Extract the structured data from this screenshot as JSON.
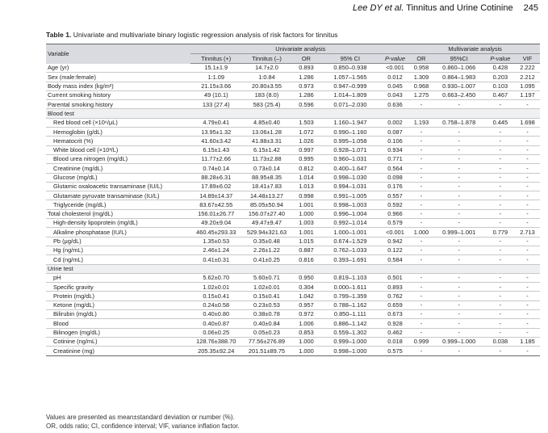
{
  "running_head": {
    "authors": "Lee DY et al.",
    "title": "Tinnitus and Urine Cotinine",
    "page": "245"
  },
  "caption": {
    "label": "Table 1.",
    "text": "Univariate and multivariate binary logistic regression analysis of risk factors for tinnitus"
  },
  "header": {
    "variable": "Variable",
    "univariate": "Univariate analysis",
    "multivariate": "Multivariate analysis",
    "uni_cols": [
      "Tinnitus (+)",
      "Tinnitus (–)",
      "OR",
      "95% CI",
      "P-value"
    ],
    "multi_cols": [
      "OR",
      "95%CI",
      "P-value",
      "VIF"
    ]
  },
  "rows": [
    {
      "label": "Age (yr)",
      "indent": false,
      "section": false,
      "cells": [
        "15.1±1.9",
        "14.7±2.0",
        "0.893",
        "0.850–0.938",
        "<0.001",
        "0.958",
        "0.860–1.066",
        "0.428",
        "2.222"
      ]
    },
    {
      "label": "Sex (male:female)",
      "indent": false,
      "section": false,
      "cells": [
        "1:1.09",
        "1:0.84",
        "1.286",
        "1.057–1.565",
        "0.012",
        "1.309",
        "0.864–1.983",
        "0.203",
        "2.212"
      ]
    },
    {
      "label": "Body mass index (kg/m²)",
      "indent": false,
      "section": false,
      "cells": [
        "21.15±3.66",
        "20.80±3.55",
        "0.973",
        "0.947–0.999",
        "0.045",
        "0.968",
        "0.930–1.007",
        "0.103",
        "1.095"
      ]
    },
    {
      "label": "Current smoking history",
      "indent": false,
      "section": false,
      "cells": [
        "49 (10.1)",
        "183 (8.0)",
        "1.286",
        "1.014–1.809",
        "0.043",
        "1.275",
        "0.663–2.450",
        "0.467",
        "1.197"
      ]
    },
    {
      "label": "Parental smoking history",
      "indent": false,
      "section": false,
      "cells": [
        "133 (27.4)",
        "583 (25.4)",
        "0.596",
        "0.071–2.030",
        "0.636",
        "-",
        "-",
        "-",
        "-"
      ]
    },
    {
      "label": "Blood test",
      "indent": false,
      "section": true,
      "cells": [
        "",
        "",
        "",
        "",
        "",
        "",
        "",
        "",
        ""
      ]
    },
    {
      "label": "Red blood cell (×10⁶/μL)",
      "indent": true,
      "section": false,
      "cells": [
        "4.79±0.41",
        "4.85±0.40",
        "1.503",
        "1.160–1.947",
        "0.002",
        "1.193",
        "0.758–1.878",
        "0.445",
        "1.698"
      ]
    },
    {
      "label": "Hemoglobin (g/dL)",
      "indent": true,
      "section": false,
      "cells": [
        "13.95±1.32",
        "13.06±1.28",
        "1.072",
        "0.990–1.160",
        "0.087",
        "-",
        "-",
        "-",
        "-"
      ]
    },
    {
      "label": "Hematocrit (%)",
      "indent": true,
      "section": false,
      "cells": [
        "41.60±3.42",
        "41.88±3.31",
        "1.026",
        "0.995–1.058",
        "0.106",
        "-",
        "-",
        "-",
        "-"
      ]
    },
    {
      "label": "White blood cell (×10³/L)",
      "indent": true,
      "section": false,
      "cells": [
        "6.15±1.43",
        "6.15±1.42",
        "0.997",
        "0.928–1.071",
        "0.934",
        "-",
        "-",
        "-",
        "-"
      ]
    },
    {
      "label": "Blood urea nitrogen (mg/dL)",
      "indent": true,
      "section": false,
      "cells": [
        "11.77±2.66",
        "11.73±2.88",
        "0.995",
        "0.960–1.031",
        "0.771",
        "-",
        "-",
        "-",
        "-"
      ]
    },
    {
      "label": "Creatinine (mg/dL)",
      "indent": true,
      "section": false,
      "cells": [
        "0.74±0.14",
        "0.73±0.14",
        "0.812",
        "0.400–1.647",
        "0.564",
        "-",
        "-",
        "-",
        "-"
      ]
    },
    {
      "label": "Glucose (mg/dL)",
      "indent": true,
      "section": false,
      "cells": [
        "88.28±6.31",
        "88.95±8.35",
        "1.014",
        "0.998–1.030",
        "0.098",
        "-",
        "-",
        "-",
        "-"
      ]
    },
    {
      "label": "Glutamic oxaloacetic transaminase (IU/L)",
      "indent": true,
      "section": false,
      "cells": [
        "17.89±6.02",
        "18.41±7.83",
        "1.013",
        "0.994–1.031",
        "0.176",
        "-",
        "-",
        "-",
        "-"
      ]
    },
    {
      "label": "Glutamate pyruvate transaminase (IU/L)",
      "indent": true,
      "section": false,
      "cells": [
        "14.89±14.37",
        "14.48±13.27",
        "0.998",
        "0.991–1.005",
        "0.557",
        "-",
        "-",
        "-",
        "-"
      ]
    },
    {
      "label": "Triglyceride (mg/dL)",
      "indent": true,
      "section": false,
      "cells": [
        "83.67±42.55",
        "85.05±50.94",
        "1.001",
        "0.998–1.003",
        "0.592",
        "-",
        "-",
        "-",
        "-"
      ]
    },
    {
      "label": "Total cholesterol (mg/dL)",
      "indent": false,
      "section": false,
      "cells": [
        "156.01±26.77",
        "156.07±27.40",
        "1.000",
        "0.996–1.004",
        "0.966",
        "-",
        "-",
        "-",
        "-"
      ]
    },
    {
      "label": "High-density lipoprotein (mg/dL)",
      "indent": true,
      "section": false,
      "cells": [
        "49.20±9.04",
        "49.47±9.47",
        "1.003",
        "0.992–1.014",
        "0.579",
        "-",
        "-",
        "-",
        "-"
      ]
    },
    {
      "label": "Alkaline phosphatase (IU/L)",
      "indent": true,
      "section": false,
      "cells": [
        "460.45±293.33",
        "529.94±321.63",
        "1.001",
        "1.000–1.001",
        "<0.001",
        "1.000",
        "0.999–1.001",
        "0.779",
        "2.713"
      ]
    },
    {
      "label": "Pb (μg/dL)",
      "indent": true,
      "section": false,
      "cells": [
        "1.35±0.53",
        "0.35±0.48",
        "1.015",
        "0.674–1.529",
        "0.942",
        "-",
        "-",
        "-",
        "-"
      ]
    },
    {
      "label": "Hg (ng/mL)",
      "indent": true,
      "section": false,
      "cells": [
        "2.46±1.24",
        "2.26±1.22",
        "0.887",
        "0.762–1.033",
        "0.122",
        "-",
        "-",
        "-",
        "-"
      ]
    },
    {
      "label": "Cd (ng/mL)",
      "indent": true,
      "section": false,
      "cells": [
        "0.41±0.31",
        "0.41±0.25",
        "0.816",
        "0.393–1.691",
        "0.584",
        "-",
        "-",
        "-",
        "-"
      ]
    },
    {
      "label": "Urine test",
      "indent": false,
      "section": true,
      "cells": [
        "",
        "",
        "",
        "",
        "",
        "",
        "",
        "",
        ""
      ]
    },
    {
      "label": "pH",
      "indent": true,
      "section": false,
      "cells": [
        "5.62±0.70",
        "5.60±0.71",
        "0.950",
        "0.819–1.103",
        "0.501",
        "-",
        "-",
        "-",
        "-"
      ]
    },
    {
      "label": "Specific gravity",
      "indent": true,
      "section": false,
      "cells": [
        "1.02±0.01",
        "1.02±0.01",
        "0.304",
        "0.000–1.611",
        "0.893",
        "-",
        "-",
        "-",
        "-"
      ]
    },
    {
      "label": "Protein (mg/dL)",
      "indent": true,
      "section": false,
      "cells": [
        "0.15±0.41",
        "0.15±0.41",
        "1.042",
        "0.799–1.359",
        "0.762",
        "-",
        "-",
        "-",
        "-"
      ]
    },
    {
      "label": "Ketone (mg/dL)",
      "indent": true,
      "section": false,
      "cells": [
        "0.24±0.58",
        "0.23±0.53",
        "0.957",
        "0.788–1.162",
        "0.659",
        "-",
        "-",
        "-",
        "-"
      ]
    },
    {
      "label": "Bilirubin (mg/dL)",
      "indent": true,
      "section": false,
      "cells": [
        "0.40±0.80",
        "0.38±0.78",
        "0.972",
        "0.850–1.111",
        "0.673",
        "-",
        "-",
        "-",
        "-"
      ]
    },
    {
      "label": "Blood",
      "indent": true,
      "section": false,
      "cells": [
        "0.40±0.87",
        "0.40±0.84",
        "1.006",
        "0.886–1.142",
        "0.928",
        "-",
        "-",
        "-",
        "-"
      ]
    },
    {
      "label": "Bilinogen (mg/dL)",
      "indent": true,
      "section": false,
      "cells": [
        "0.06±0.25",
        "0.05±0.23",
        "0.853",
        "0.559–1.302",
        "0.462",
        "-",
        "-",
        "-",
        "-"
      ]
    },
    {
      "label": "Cotinine (ng/mL)",
      "indent": true,
      "section": false,
      "cells": [
        "128.76±388.70",
        "77.56±276.89",
        "1.000",
        "0.999–1.000",
        "0.018",
        "0.999",
        "0.999–1.000",
        "0.038",
        "1.185"
      ]
    },
    {
      "label": "Creatinine (mg)",
      "indent": true,
      "section": false,
      "cells": [
        "205.35±92.24",
        "201.51±89.75",
        "1.000",
        "0.998–1.000",
        "0.575",
        "-",
        "-",
        "-",
        "-"
      ]
    }
  ],
  "footnotes": [
    "Values are presented as mean±standard deviation or number (%).",
    "OR, odds ratio; CI, confidence interval; VIF, variance inflation factor."
  ]
}
